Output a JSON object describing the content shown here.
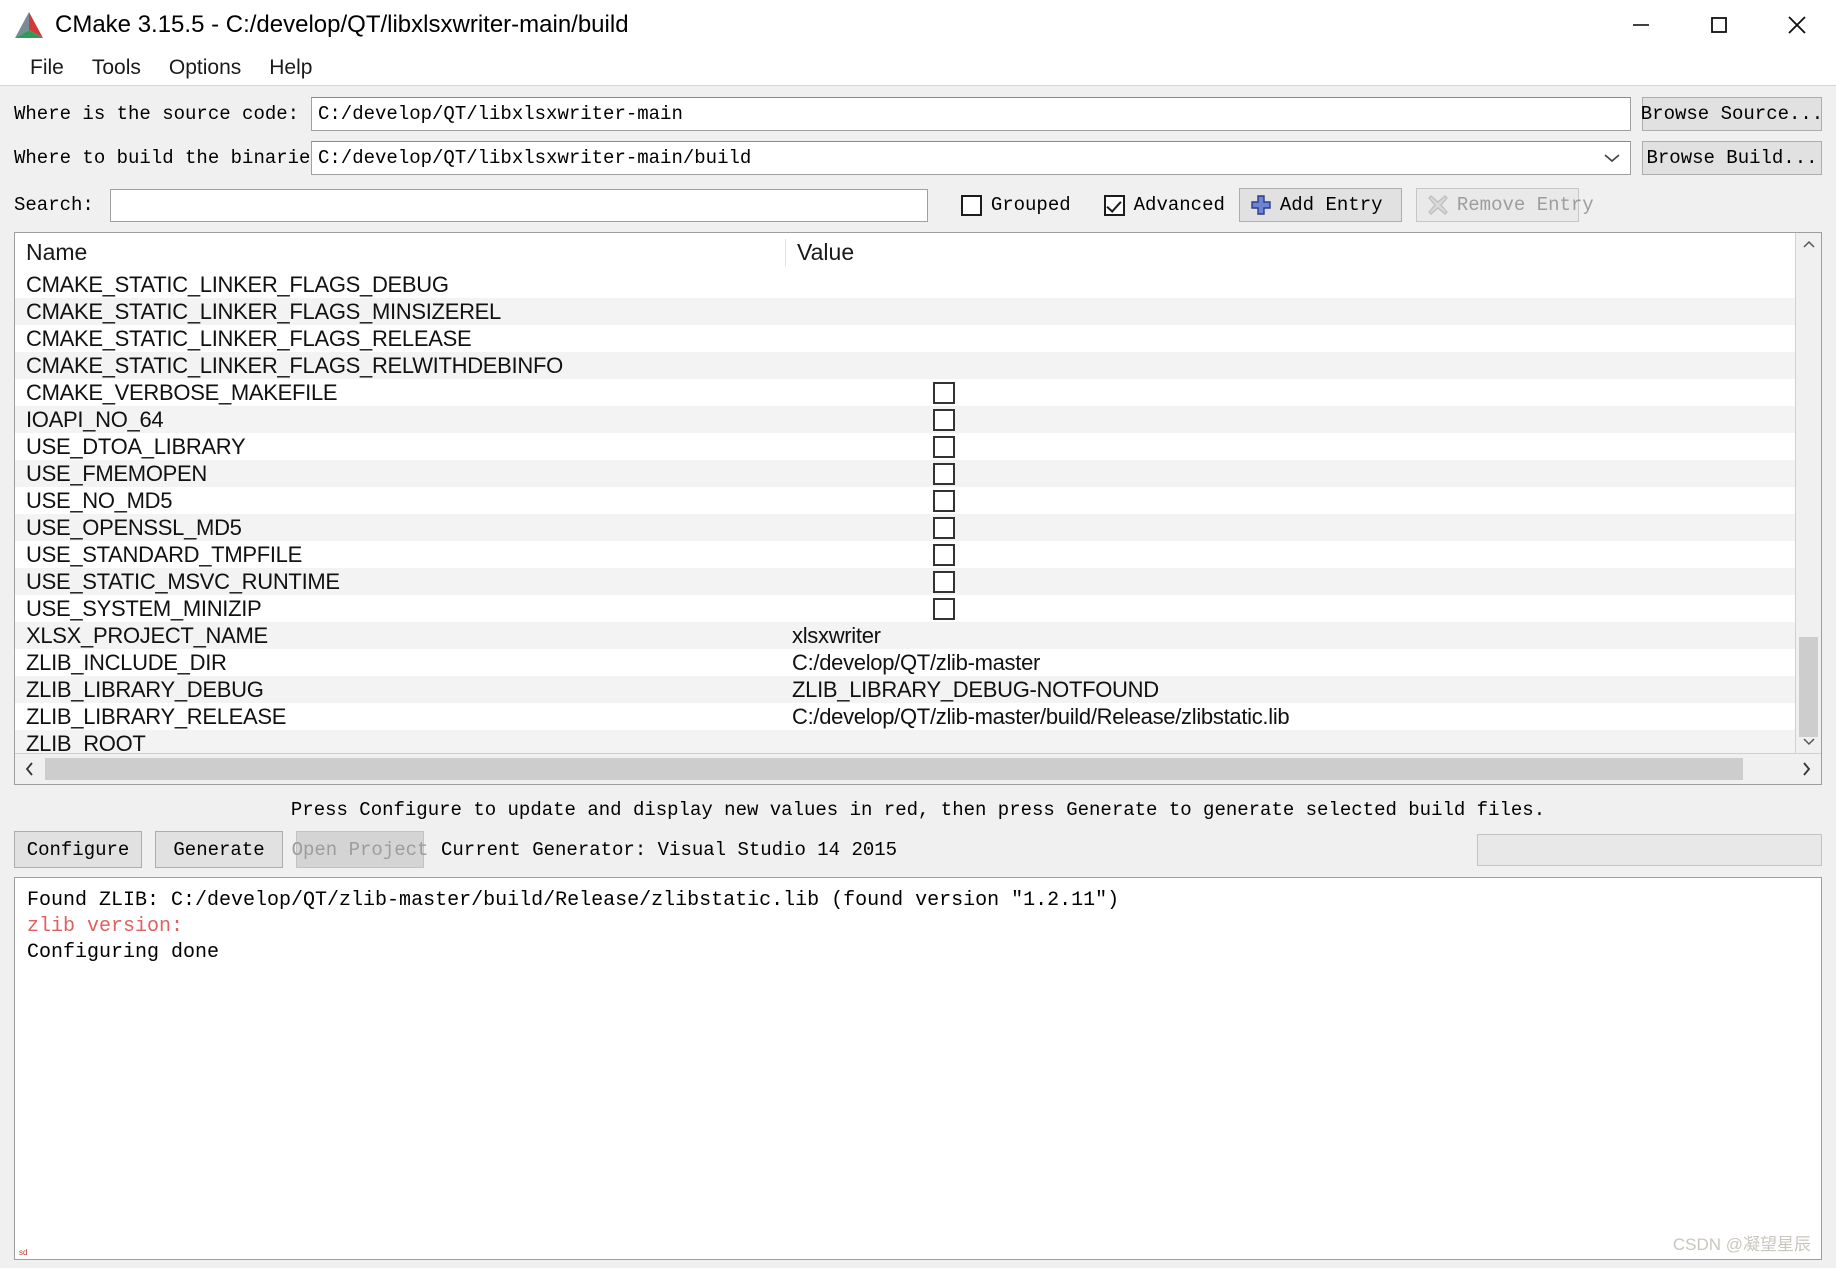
{
  "window": {
    "title": "CMake 3.15.5 - C:/develop/QT/libxlsxwriter-main/build",
    "minimize_label": "minimize",
    "maximize_label": "maximize",
    "close_label": "close"
  },
  "menu": {
    "items": [
      {
        "label": "File"
      },
      {
        "label": "Tools"
      },
      {
        "label": "Options"
      },
      {
        "label": "Help"
      }
    ]
  },
  "paths": {
    "source_label": "Where is the source code:",
    "source_value": "C:/develop/QT/libxlsxwriter-main",
    "browse_source_label": "Browse Source...",
    "build_label": "Where to build the binaries:",
    "build_value": "C:/develop/QT/libxlsxwriter-main/build",
    "browse_build_label": "Browse Build..."
  },
  "toolbar": {
    "search_label": "Search:",
    "search_value": "",
    "search_placeholder": "",
    "grouped_label": "Grouped",
    "grouped_checked": false,
    "advanced_label": "Advanced",
    "advanced_checked": true,
    "add_entry_label": "Add Entry",
    "remove_entry_label": "Remove Entry",
    "remove_entry_disabled": true,
    "add_icon_color": "#3b4fa8"
  },
  "cache_table": {
    "columns": [
      "Name",
      "Value"
    ],
    "rows": [
      {
        "name": "CMAKE_STATIC_LINKER_FLAGS_DEBUG",
        "type": "text",
        "value": ""
      },
      {
        "name": "CMAKE_STATIC_LINKER_FLAGS_MINSIZEREL",
        "type": "text",
        "value": ""
      },
      {
        "name": "CMAKE_STATIC_LINKER_FLAGS_RELEASE",
        "type": "text",
        "value": ""
      },
      {
        "name": "CMAKE_STATIC_LINKER_FLAGS_RELWITHDEBINFO",
        "type": "text",
        "value": ""
      },
      {
        "name": "CMAKE_VERBOSE_MAKEFILE",
        "type": "checkbox",
        "checked": false,
        "value": ""
      },
      {
        "name": "IOAPI_NO_64",
        "type": "checkbox",
        "checked": false,
        "value": ""
      },
      {
        "name": "USE_DTOA_LIBRARY",
        "type": "checkbox",
        "checked": false,
        "value": ""
      },
      {
        "name": "USE_FMEMOPEN",
        "type": "checkbox",
        "checked": false,
        "value": ""
      },
      {
        "name": "USE_NO_MD5",
        "type": "checkbox",
        "checked": false,
        "value": ""
      },
      {
        "name": "USE_OPENSSL_MD5",
        "type": "checkbox",
        "checked": false,
        "value": ""
      },
      {
        "name": "USE_STANDARD_TMPFILE",
        "type": "checkbox",
        "checked": false,
        "value": ""
      },
      {
        "name": "USE_STATIC_MSVC_RUNTIME",
        "type": "checkbox",
        "checked": false,
        "value": ""
      },
      {
        "name": "USE_SYSTEM_MINIZIP",
        "type": "checkbox",
        "checked": false,
        "value": ""
      },
      {
        "name": "XLSX_PROJECT_NAME",
        "type": "text",
        "value": "xlsxwriter"
      },
      {
        "name": "ZLIB_INCLUDE_DIR",
        "type": "text",
        "value": "C:/develop/QT/zlib-master"
      },
      {
        "name": "ZLIB_LIBRARY_DEBUG",
        "type": "text",
        "value": "ZLIB_LIBRARY_DEBUG-NOTFOUND"
      },
      {
        "name": "ZLIB_LIBRARY_RELEASE",
        "type": "text",
        "value": "C:/develop/QT/zlib-master/build/Release/zlibstatic.lib"
      },
      {
        "name": "ZLIB_ROOT",
        "type": "text",
        "value": ""
      }
    ]
  },
  "status": {
    "hint": "Press Configure to update and display new values in red, then press Generate to generate selected build files."
  },
  "actions": {
    "configure_label": "Configure",
    "generate_label": "Generate",
    "open_project_label": "Open Project",
    "open_project_disabled": true,
    "current_generator": "Current Generator: Visual Studio 14 2015"
  },
  "log": {
    "lines": [
      {
        "text": "Found ZLIB: C:/develop/QT/zlib-master/build/Release/zlibstatic.lib (found version \"1.2.11\")",
        "color": "normal"
      },
      {
        "text": "zlib version:",
        "color": "red"
      },
      {
        "text": "Configuring done",
        "color": "normal"
      }
    ],
    "red_color": "#e06060",
    "watermark": "CSDN @凝望星辰",
    "corner_mark": "sd"
  }
}
